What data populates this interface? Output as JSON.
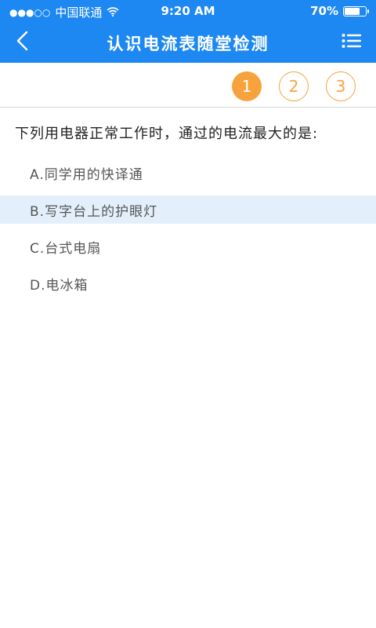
{
  "status_bar": {
    "signal": "●●●○○",
    "carrier": "中国联通",
    "time": "9:20 AM",
    "battery_percent": "70%",
    "battery_level": 0.7
  },
  "header": {
    "title": "认识电流表随堂检测",
    "back_icon": "chevron-left-icon",
    "menu_icon": "list-icon"
  },
  "question_nav": {
    "items": [
      "1",
      "2",
      "3"
    ],
    "active_index": 0
  },
  "question": {
    "text": "下列用电器正常工作时，通过的电流最大的是:",
    "options": [
      "A.同学用的快译通",
      "B.写字台上的护眼灯",
      "C.台式电扇",
      "D.电冰箱"
    ],
    "selected_index": 1
  },
  "colors": {
    "primary": "#1e88f2",
    "accent": "#f7a33d",
    "selected_bg": "#e3f0fc"
  }
}
